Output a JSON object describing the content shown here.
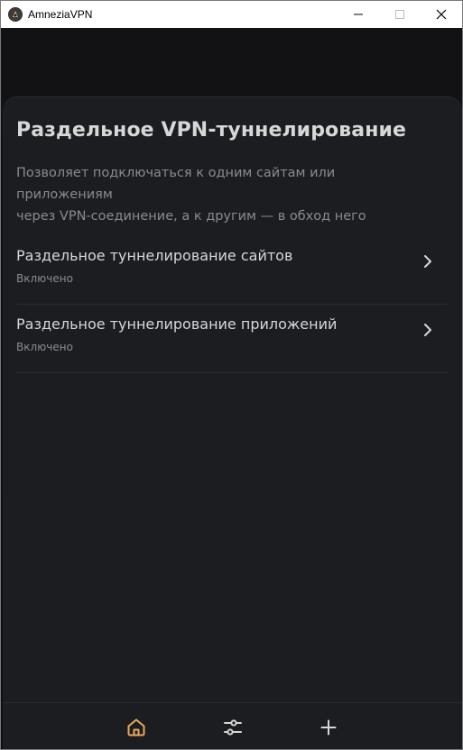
{
  "window": {
    "title": "AmneziaVPN"
  },
  "page": {
    "title": "Раздельное VPN-туннелирование",
    "description_line1": "Позволяет подключаться к одним сайтам или приложениям",
    "description_line2": "через VPN-соединение, а к другим — в обход него"
  },
  "items": [
    {
      "label": "Раздельное туннелирование сайтов",
      "status": "Включено"
    },
    {
      "label": "Раздельное туннелирование приложений",
      "status": "Включено"
    }
  ],
  "tabbar": {
    "tabs": [
      {
        "icon": "home-icon",
        "active": true
      },
      {
        "icon": "settings-sliders-icon",
        "active": false
      },
      {
        "icon": "plus-icon",
        "active": false
      }
    ]
  },
  "colors": {
    "accent": "#e8a85c",
    "background": "#0e0e11",
    "surface": "#1c1d21",
    "text_primary": "#d7d7d7",
    "text_secondary": "#878b91"
  }
}
